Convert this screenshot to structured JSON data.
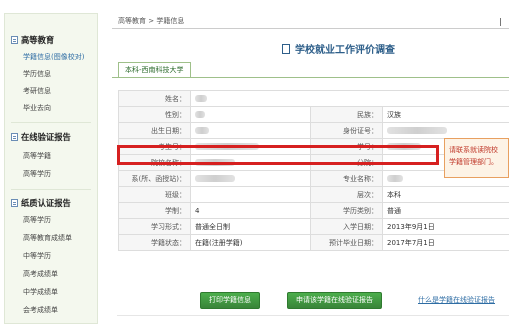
{
  "sidebar": {
    "sections": [
      {
        "title": "高等教育",
        "items": [
          {
            "label": "学籍信息(图像校对)",
            "active": true
          },
          {
            "label": "学历信息",
            "active": false
          },
          {
            "label": "考研信息",
            "active": false
          },
          {
            "label": "毕业去向",
            "active": false
          }
        ]
      },
      {
        "title": "在线验证报告",
        "items": [
          {
            "label": "高等学籍",
            "active": false
          },
          {
            "label": "高等学历",
            "active": false
          }
        ]
      },
      {
        "title": "纸质认证报告",
        "items": [
          {
            "label": "高等学历",
            "active": false
          },
          {
            "label": "高等教育成绩单",
            "active": false
          },
          {
            "label": "中等学历",
            "active": false
          },
          {
            "label": "高考成绩单",
            "active": false
          },
          {
            "label": "中学成绩单",
            "active": false
          },
          {
            "label": "会考成绩单",
            "active": false
          }
        ]
      }
    ]
  },
  "breadcrumb": "高等教育 > 学籍信息",
  "page_title": "学校就业工作评价调查",
  "tab_label": "本科-西南科技大学",
  "info": {
    "name_label": "姓名：",
    "gender_label": "性别：",
    "ethnicity_label": "民族：",
    "ethnicity_value": "汉族",
    "birth_label": "出生日期：",
    "id_label": "身份证号：",
    "exam_no_label": "考生号：",
    "student_no_label": "学号：",
    "school_label": "院校名称：",
    "campus_label": "分院：",
    "dept_label": "系(所、函授站)：",
    "major_label": "专业名称：",
    "class_label": "班级：",
    "level_label": "层次：",
    "level_value": "本科",
    "duration_label": "学制：",
    "duration_value": "4",
    "category_label": "学历类别：",
    "category_value": "普通",
    "form_label": "学习形式：",
    "form_value": "普通全日制",
    "enroll_label": "入学日期：",
    "enroll_value": "2013年9月1日",
    "status_label": "学籍状态：",
    "status_value": "在籍(注册学籍)",
    "grad_label": "预计毕业日期：",
    "grad_value": "2017年7月1日"
  },
  "tooltip": {
    "line1": "请联系就读院校",
    "line2": "学籍管理部门。"
  },
  "buttons": {
    "print": "打印学籍信息",
    "verify": "申请该学籍在线验证报告",
    "help_link": "什么是学籍在线验证报告"
  },
  "colors": {
    "accent_green": "#398439",
    "highlight_red": "#d62020",
    "title_blue": "#2e5f8a"
  }
}
